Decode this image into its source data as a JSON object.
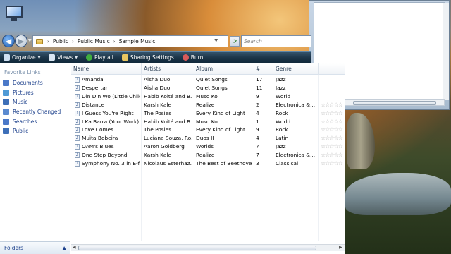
{
  "address": {
    "crumbs": [
      "Public",
      "Public Music",
      "Sample Music"
    ],
    "search_placeholder": "Search"
  },
  "toolbar": {
    "items": [
      {
        "label": "Organize",
        "icon": "organize-icon",
        "dropdown": true
      },
      {
        "label": "Views",
        "icon": "views-icon",
        "dropdown": true
      },
      {
        "label": "Play all",
        "icon": "play-icon",
        "dropdown": false
      },
      {
        "label": "Sharing Settings",
        "icon": "sharing-icon",
        "dropdown": false
      },
      {
        "label": "Burn",
        "icon": "burn-icon",
        "dropdown": false
      }
    ]
  },
  "nav": {
    "title": "Favorite Links",
    "links": [
      {
        "label": "Documents",
        "color": "#4a78c8"
      },
      {
        "label": "Pictures",
        "color": "#4f9ad6"
      },
      {
        "label": "Music",
        "color": "#3d6fb8"
      },
      {
        "label": "Recently Changed",
        "color": "#5a8ad0"
      },
      {
        "label": "Searches",
        "color": "#4a78c8"
      },
      {
        "label": "Public",
        "color": "#3d6fb8"
      }
    ],
    "folders_label": "Folders"
  },
  "columns": [
    "Name",
    "Artists",
    "Album",
    "#",
    "Genre"
  ],
  "rows": [
    {
      "name": "Amanda",
      "artist": "Aisha Duo",
      "album": "Quiet Songs",
      "num": "17",
      "genre": "Jazz"
    },
    {
      "name": "Despertar",
      "artist": "Aisha Duo",
      "album": "Quiet Songs",
      "num": "11",
      "genre": "Jazz"
    },
    {
      "name": "Din Din Wo (Little Child)",
      "artist": "Habib Koité and B...",
      "album": "Muso Ko",
      "num": "9",
      "genre": "World"
    },
    {
      "name": "Distance",
      "artist": "Karsh Kale",
      "album": "Realize",
      "num": "2",
      "genre": "Electronica &..."
    },
    {
      "name": "I Guess You're Right",
      "artist": "The Posies",
      "album": "Every Kind of Light",
      "num": "4",
      "genre": "Rock"
    },
    {
      "name": "I Ka Barra (Your Work)",
      "artist": "Habib Koité and B...",
      "album": "Muso Ko",
      "num": "1",
      "genre": "World"
    },
    {
      "name": "Love Comes",
      "artist": "The Posies",
      "album": "Every Kind of Light",
      "num": "9",
      "genre": "Rock"
    },
    {
      "name": "Muita Bobeira",
      "artist": "Luciana Souza, Ro...",
      "album": "Duos II",
      "num": "4",
      "genre": "Latin"
    },
    {
      "name": "OAM's Blues",
      "artist": "Aaron Goldberg",
      "album": "Worlds",
      "num": "7",
      "genre": "Jazz"
    },
    {
      "name": "One Step Beyond",
      "artist": "Karsh Kale",
      "album": "Realize",
      "num": "7",
      "genre": "Electronica &..."
    },
    {
      "name": "Symphony No. 3 in E-f...",
      "artist": "Nicolaus Esterhaz...",
      "album": "The Best of Beethoven",
      "num": "3",
      "genre": "Classical"
    }
  ],
  "rating_glyph": "☆☆☆☆☆"
}
